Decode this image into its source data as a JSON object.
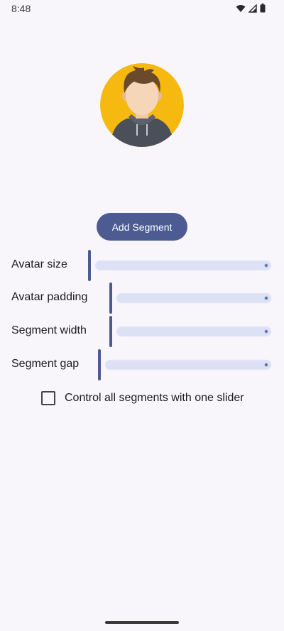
{
  "status_bar": {
    "time": "8:48",
    "icons": [
      "wifi-icon",
      "signal-icon",
      "battery-icon"
    ]
  },
  "avatar": {
    "icon": "avatar-illustration-icon"
  },
  "add_segment_button": {
    "label": "Add Segment"
  },
  "sliders": [
    {
      "label": "Avatar size",
      "value_fraction": 0.0
    },
    {
      "label": "Avatar padding",
      "value_fraction": 0.0
    },
    {
      "label": "Segment width",
      "value_fraction": 0.0
    },
    {
      "label": "Segment gap",
      "value_fraction": 0.0
    }
  ],
  "control_all": {
    "label": "Control all segments with one slider",
    "checked": false
  },
  "colors": {
    "accent": "#4c5c92",
    "track": "#dde1f5",
    "background": "#f8f6fb",
    "avatar_bg": "#f5b90f"
  }
}
